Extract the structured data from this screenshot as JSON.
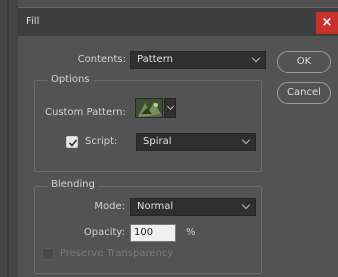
{
  "window": {
    "title": "Fill"
  },
  "contents": {
    "label": "Contents:",
    "value": "Pattern"
  },
  "buttons": {
    "ok": "OK",
    "cancel": "Cancel"
  },
  "options": {
    "title": "Options",
    "custom_pattern_label": "Custom Pattern:",
    "script_label": "Script:",
    "script_checked": true,
    "script_value": "Spiral"
  },
  "blending": {
    "title": "Blending",
    "mode_label": "Mode:",
    "mode_value": "Normal",
    "opacity_label": "Opacity:",
    "opacity_value": "100",
    "opacity_unit": "%",
    "preserve_label": "Preserve Transparency",
    "preserve_checked": false
  },
  "colors": {
    "close": "#c8302b",
    "panel": "#535353",
    "titlebar": "#3d3d3d"
  },
  "icons": {
    "close": "close-icon",
    "check": "check-icon",
    "chevron": "chevron-down-icon"
  }
}
